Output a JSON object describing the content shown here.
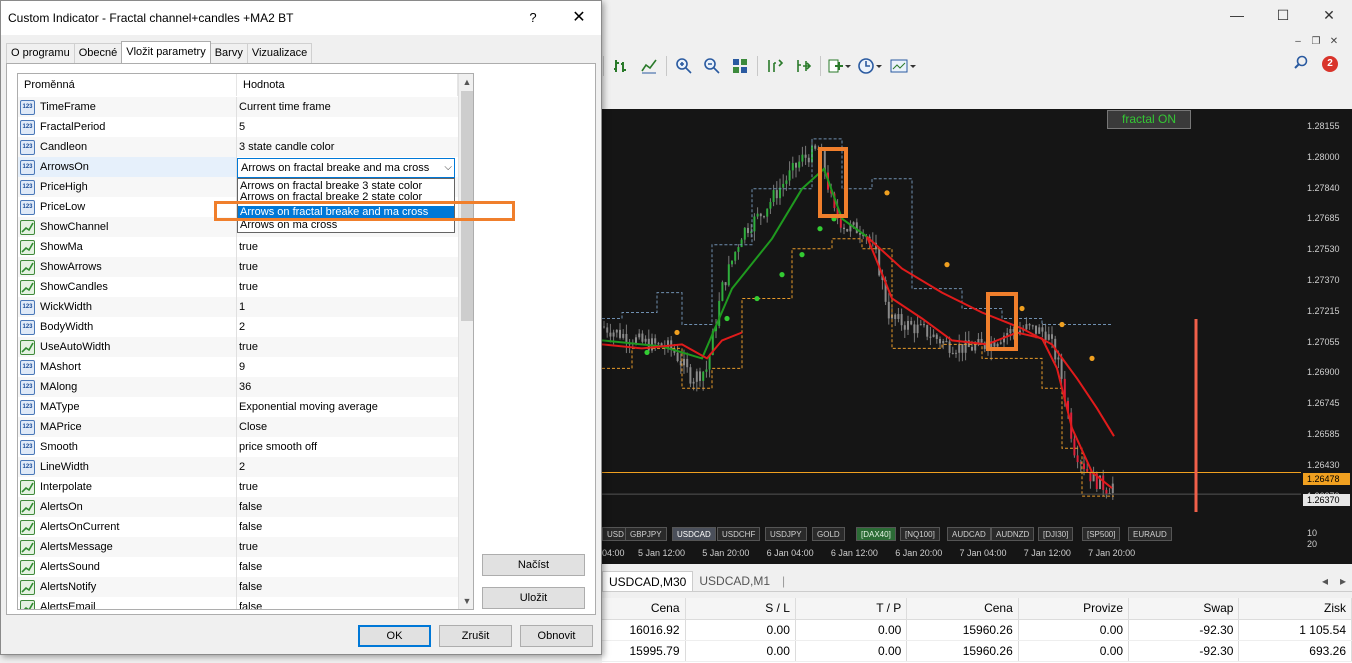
{
  "dialog": {
    "title": "Custom Indicator - Fractal channel+candles +MA2  BT",
    "help": "?",
    "close": "✕",
    "tabs": [
      "O programu",
      "Obecné",
      "Vložit parametry",
      "Barvy",
      "Vizualizace"
    ],
    "active_tab": 2,
    "grid": {
      "col_name": "Proměnná",
      "col_value": "Hodnota",
      "rows": [
        {
          "type": "num",
          "name": "TimeFrame",
          "value": "Current time frame"
        },
        {
          "type": "num",
          "name": "FractalPeriod",
          "value": "5"
        },
        {
          "type": "num",
          "name": "Candleon",
          "value": "3 state candle color"
        },
        {
          "type": "num",
          "name": "ArrowsOn",
          "value": ""
        },
        {
          "type": "num",
          "name": "PriceHigh",
          "value": ""
        },
        {
          "type": "num",
          "name": "PriceLow",
          "value": ""
        },
        {
          "type": "bool",
          "name": "ShowChannel",
          "value": ""
        },
        {
          "type": "bool",
          "name": "ShowMa",
          "value": "true"
        },
        {
          "type": "bool",
          "name": "ShowArrows",
          "value": "true"
        },
        {
          "type": "bool",
          "name": "ShowCandles",
          "value": "true"
        },
        {
          "type": "num",
          "name": "WickWidth",
          "value": "1"
        },
        {
          "type": "num",
          "name": "BodyWidth",
          "value": "2"
        },
        {
          "type": "bool",
          "name": "UseAutoWidth",
          "value": "true"
        },
        {
          "type": "num",
          "name": "MAshort",
          "value": "9"
        },
        {
          "type": "num",
          "name": "MAlong",
          "value": "36"
        },
        {
          "type": "num",
          "name": "MAType",
          "value": "Exponential moving average"
        },
        {
          "type": "num",
          "name": "MAPrice",
          "value": "Close"
        },
        {
          "type": "num",
          "name": "Smooth",
          "value": "price smooth off"
        },
        {
          "type": "num",
          "name": "LineWidth",
          "value": "2"
        },
        {
          "type": "bool",
          "name": "Interpolate",
          "value": "true"
        },
        {
          "type": "bool",
          "name": "AlertsOn",
          "value": "false"
        },
        {
          "type": "bool",
          "name": "AlertsOnCurrent",
          "value": "false"
        },
        {
          "type": "bool",
          "name": "AlertsMessage",
          "value": "true"
        },
        {
          "type": "bool",
          "name": "AlertsSound",
          "value": "false"
        },
        {
          "type": "bool",
          "name": "AlertsNotify",
          "value": "false"
        },
        {
          "type": "bool",
          "name": "AlertsEmail",
          "value": "false"
        }
      ]
    },
    "combo_value": "Arrows on fractal breake and ma cross",
    "dropdown_options": [
      "Arrows on fractal breake 3 state color",
      "Arrows on fractal breake 2 state color",
      "Arrows on fractal breake and ma cross",
      "Arrows on  ma cross"
    ],
    "dropdown_selected": 2,
    "buttons": {
      "load": "Načíst",
      "save": "Uložit",
      "ok": "OK",
      "reset": "Zrušit",
      "restore": "Obnovit"
    }
  },
  "terminal": {
    "window_controls": [
      "—",
      "☐",
      "✕"
    ],
    "mdi_controls": [
      "–",
      "❐",
      "✕"
    ],
    "notifications_count": "2",
    "chart": {
      "label": "fractal ON",
      "price_ticks": [
        "1.28155",
        "1.28000",
        "1.27840",
        "1.27685",
        "1.27530",
        "1.27370",
        "1.27215",
        "1.27055",
        "1.26900",
        "1.26745",
        "1.26585",
        "1.26430",
        "1.26270"
      ],
      "price_tag_ask": "1.26478",
      "price_tag_bid": "1.26370",
      "axis_bottom": [
        "10",
        "20"
      ],
      "time_ticks": [
        "04:00",
        "5 Jan 12:00",
        "5 Jan 20:00",
        "6 Jan 04:00",
        "6 Jan 12:00",
        "6 Jan 20:00",
        "7 Jan 04:00",
        "7 Jan 12:00",
        "7 Jan 20:00"
      ],
      "symbols": [
        "USD",
        "GBPJPY",
        "USDCAD",
        "USDCHF",
        "USDJPY",
        "GOLD",
        "[DAX40]",
        "[NQ100]",
        "AUDCAD",
        "AUDNZD",
        "[DJI30]",
        "[SP500]",
        "EURAUD"
      ],
      "active_symbol": "USDCAD",
      "highlight_symbol": "[DAX40]"
    },
    "chart_tabs": [
      "USDCAD,M30",
      "USDCAD,M1"
    ],
    "table": {
      "headers": [
        "Cena",
        "S / L",
        "T / P",
        "Cena",
        "Provize",
        "Swap",
        "Zisk"
      ],
      "rows": [
        [
          "16016.92",
          "0.00",
          "0.00",
          "15960.26",
          "0.00",
          "-92.30",
          "1 105.54"
        ],
        [
          "15995.79",
          "0.00",
          "0.00",
          "15960.26",
          "0.00",
          "-92.30",
          "693.26"
        ]
      ]
    }
  },
  "colors": {
    "ma_short": "#1f9a1f",
    "ma_long": "#e01b1b",
    "arrow_up": "#33cc33",
    "arrow_down": "#f0a020",
    "highlight": "#f07f2c",
    "fractal_lines": "#e89a2a",
    "fractal_lines_upper": "#6f8fb0"
  }
}
